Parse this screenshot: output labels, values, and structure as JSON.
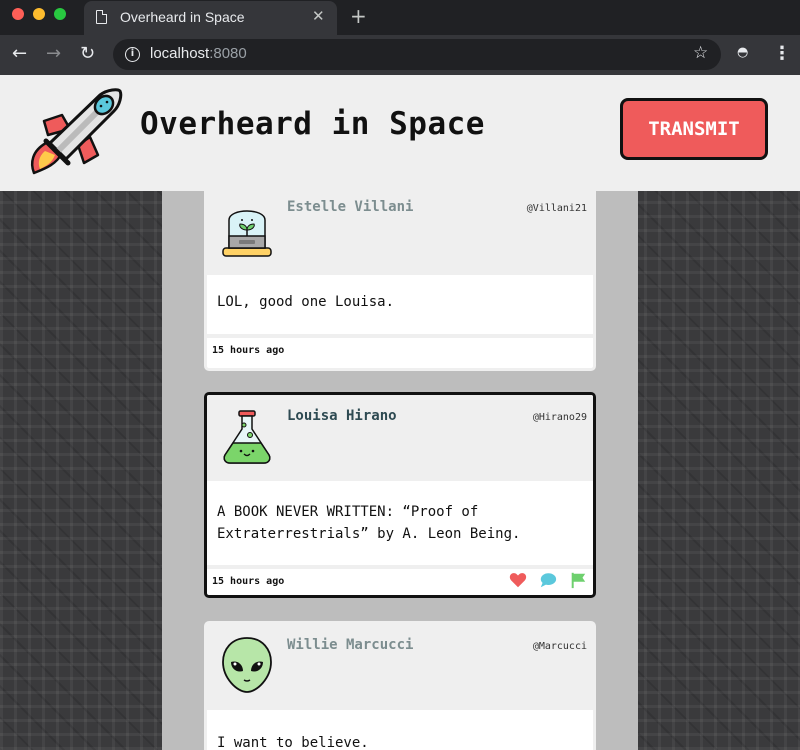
{
  "browser": {
    "tab_title": "Overheard in Space",
    "url_host": "localhost",
    "url_port": ":8080"
  },
  "header": {
    "site_title": "Overheard in Space",
    "transmit_label": "TRANSMIT",
    "logo_icon": "rocket-icon"
  },
  "posts": [
    {
      "author": "Estelle Villani",
      "handle": "@Villani21",
      "text": "LOL, good one Louisa.",
      "time": "15 hours ago",
      "avatar": "plant-jar-icon"
    },
    {
      "author": "Louisa Hirano",
      "handle": "@Hirano29",
      "text": "A BOOK NEVER WRITTEN: “Proof of Extraterrestrials” by A. Leon Being.",
      "time": "15 hours ago",
      "avatar": "flask-icon",
      "actions": [
        "heart-icon",
        "comment-icon",
        "flag-icon"
      ]
    },
    {
      "author": "Willie Marcucci",
      "handle": "@Marcucci",
      "text": "I want to believe.",
      "avatar": "alien-icon"
    }
  ],
  "colors": {
    "transmit_bg": "#ef5b5b",
    "heart": "#ef5b5b",
    "comment": "#5bc8dc",
    "flag": "#6ed06e"
  }
}
